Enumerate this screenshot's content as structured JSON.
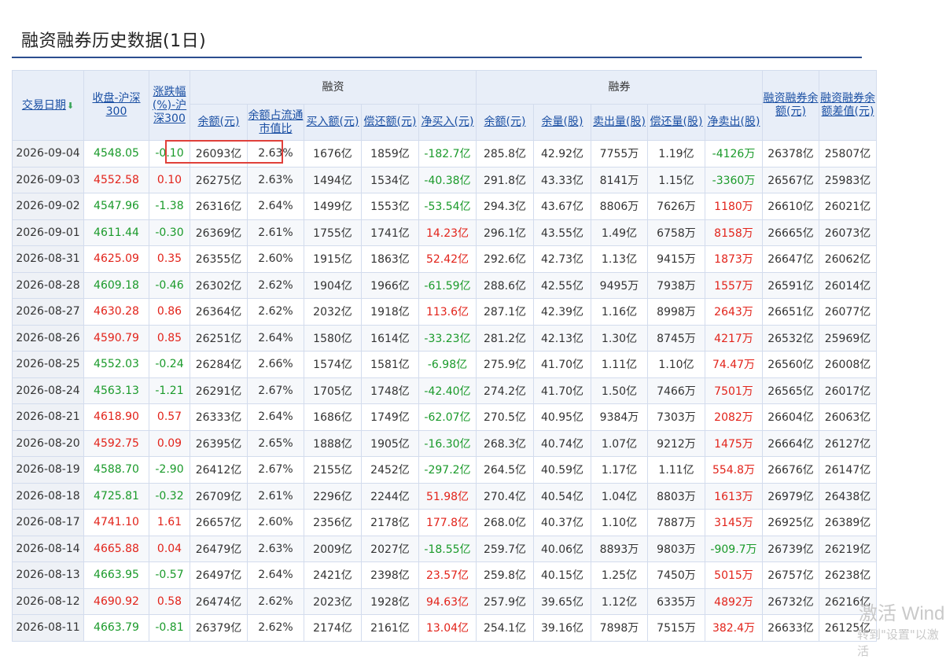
{
  "page": {
    "title": "融资融券历史数据(1日)"
  },
  "headers": {
    "date": "交易日期",
    "close": "收盘-沪深300",
    "change": "涨跌幅(%)-沪深300",
    "margin_group": "融资",
    "short_group": "融券",
    "m_balance": "余额(元)",
    "m_ratio": "余额占流通市值比",
    "m_buy": "买入额(元)",
    "m_repay": "偿还额(元)",
    "m_net": "净买入(元)",
    "s_balance": "余额(元)",
    "s_volume": "余量(股)",
    "s_sell": "卖出量(股)",
    "s_repay": "偿还量(股)",
    "s_net": "净卖出(股)",
    "total": "融资融券余额(元)",
    "diff": "融资融券余额差值(元)"
  },
  "rows": [
    {
      "date": "2026-09-04",
      "close": "4548.05",
      "chg": "-0.10",
      "mb": "26093亿",
      "mr": "2.63%",
      "buy": "1676亿",
      "repay": "1859亿",
      "net": "-182.7亿",
      "sb": "285.8亿",
      "sv": "42.92亿",
      "sell": "7755万",
      "srepay": "1.19亿",
      "snet": "-4126万",
      "total": "26378亿",
      "diff": "25807亿"
    },
    {
      "date": "2026-09-03",
      "close": "4552.58",
      "chg": "0.10",
      "mb": "26275亿",
      "mr": "2.63%",
      "buy": "1494亿",
      "repay": "1534亿",
      "net": "-40.38亿",
      "sb": "291.8亿",
      "sv": "43.33亿",
      "sell": "8141万",
      "srepay": "1.15亿",
      "snet": "-3360万",
      "total": "26567亿",
      "diff": "25983亿"
    },
    {
      "date": "2026-09-02",
      "close": "4547.96",
      "chg": "-1.38",
      "mb": "26316亿",
      "mr": "2.64%",
      "buy": "1499亿",
      "repay": "1553亿",
      "net": "-53.54亿",
      "sb": "294.3亿",
      "sv": "43.67亿",
      "sell": "8806万",
      "srepay": "7626万",
      "snet": "1180万",
      "total": "26610亿",
      "diff": "26021亿"
    },
    {
      "date": "2026-09-01",
      "close": "4611.44",
      "chg": "-0.30",
      "mb": "26369亿",
      "mr": "2.61%",
      "buy": "1755亿",
      "repay": "1741亿",
      "net": "14.23亿",
      "sb": "296.1亿",
      "sv": "43.55亿",
      "sell": "1.49亿",
      "srepay": "6758万",
      "snet": "8158万",
      "total": "26665亿",
      "diff": "26073亿"
    },
    {
      "date": "2026-08-31",
      "close": "4625.09",
      "chg": "0.35",
      "mb": "26355亿",
      "mr": "2.60%",
      "buy": "1915亿",
      "repay": "1863亿",
      "net": "52.42亿",
      "sb": "292.6亿",
      "sv": "42.73亿",
      "sell": "1.13亿",
      "srepay": "9415万",
      "snet": "1873万",
      "total": "26647亿",
      "diff": "26062亿"
    },
    {
      "date": "2026-08-28",
      "close": "4609.18",
      "chg": "-0.46",
      "mb": "26302亿",
      "mr": "2.62%",
      "buy": "1904亿",
      "repay": "1966亿",
      "net": "-61.59亿",
      "sb": "288.6亿",
      "sv": "42.55亿",
      "sell": "9495万",
      "srepay": "7938万",
      "snet": "1557万",
      "total": "26591亿",
      "diff": "26014亿"
    },
    {
      "date": "2026-08-27",
      "close": "4630.28",
      "chg": "0.86",
      "mb": "26364亿",
      "mr": "2.62%",
      "buy": "2032亿",
      "repay": "1918亿",
      "net": "113.6亿",
      "sb": "287.1亿",
      "sv": "42.39亿",
      "sell": "1.16亿",
      "srepay": "8998万",
      "snet": "2643万",
      "total": "26651亿",
      "diff": "26077亿"
    },
    {
      "date": "2026-08-26",
      "close": "4590.79",
      "chg": "0.85",
      "mb": "26251亿",
      "mr": "2.64%",
      "buy": "1580亿",
      "repay": "1614亿",
      "net": "-33.23亿",
      "sb": "281.2亿",
      "sv": "42.13亿",
      "sell": "1.30亿",
      "srepay": "8745万",
      "snet": "4217万",
      "total": "26532亿",
      "diff": "25969亿"
    },
    {
      "date": "2026-08-25",
      "close": "4552.03",
      "chg": "-0.24",
      "mb": "26284亿",
      "mr": "2.66%",
      "buy": "1574亿",
      "repay": "1581亿",
      "net": "-6.98亿",
      "sb": "275.9亿",
      "sv": "41.70亿",
      "sell": "1.11亿",
      "srepay": "1.10亿",
      "snet": "74.47万",
      "total": "26560亿",
      "diff": "26008亿"
    },
    {
      "date": "2026-08-24",
      "close": "4563.13",
      "chg": "-1.21",
      "mb": "26291亿",
      "mr": "2.67%",
      "buy": "1705亿",
      "repay": "1748亿",
      "net": "-42.40亿",
      "sb": "274.2亿",
      "sv": "41.70亿",
      "sell": "1.50亿",
      "srepay": "7466万",
      "snet": "7501万",
      "total": "26565亿",
      "diff": "26017亿"
    },
    {
      "date": "2026-08-21",
      "close": "4618.90",
      "chg": "0.57",
      "mb": "26333亿",
      "mr": "2.64%",
      "buy": "1686亿",
      "repay": "1749亿",
      "net": "-62.07亿",
      "sb": "270.5亿",
      "sv": "40.95亿",
      "sell": "9384万",
      "srepay": "7303万",
      "snet": "2082万",
      "total": "26604亿",
      "diff": "26063亿"
    },
    {
      "date": "2026-08-20",
      "close": "4592.75",
      "chg": "0.09",
      "mb": "26395亿",
      "mr": "2.65%",
      "buy": "1888亿",
      "repay": "1905亿",
      "net": "-16.30亿",
      "sb": "268.3亿",
      "sv": "40.74亿",
      "sell": "1.07亿",
      "srepay": "9212万",
      "snet": "1475万",
      "total": "26664亿",
      "diff": "26127亿"
    },
    {
      "date": "2026-08-19",
      "close": "4588.70",
      "chg": "-2.90",
      "mb": "26412亿",
      "mr": "2.67%",
      "buy": "2155亿",
      "repay": "2452亿",
      "net": "-297.2亿",
      "sb": "264.5亿",
      "sv": "40.59亿",
      "sell": "1.17亿",
      "srepay": "1.11亿",
      "snet": "554.8万",
      "total": "26676亿",
      "diff": "26147亿"
    },
    {
      "date": "2026-08-18",
      "close": "4725.81",
      "chg": "-0.32",
      "mb": "26709亿",
      "mr": "2.61%",
      "buy": "2296亿",
      "repay": "2244亿",
      "net": "51.98亿",
      "sb": "270.4亿",
      "sv": "40.54亿",
      "sell": "1.04亿",
      "srepay": "8803万",
      "snet": "1613万",
      "total": "26979亿",
      "diff": "26438亿"
    },
    {
      "date": "2026-08-17",
      "close": "4741.10",
      "chg": "1.61",
      "mb": "26657亿",
      "mr": "2.60%",
      "buy": "2356亿",
      "repay": "2178亿",
      "net": "177.8亿",
      "sb": "268.0亿",
      "sv": "40.37亿",
      "sell": "1.10亿",
      "srepay": "7887万",
      "snet": "3145万",
      "total": "26925亿",
      "diff": "26389亿"
    },
    {
      "date": "2026-08-14",
      "close": "4665.88",
      "chg": "0.04",
      "mb": "26479亿",
      "mr": "2.63%",
      "buy": "2009亿",
      "repay": "2027亿",
      "net": "-18.55亿",
      "sb": "259.7亿",
      "sv": "40.06亿",
      "sell": "8893万",
      "srepay": "9803万",
      "snet": "-909.7万",
      "total": "26739亿",
      "diff": "26219亿"
    },
    {
      "date": "2026-08-13",
      "close": "4663.95",
      "chg": "-0.57",
      "mb": "26497亿",
      "mr": "2.64%",
      "buy": "2421亿",
      "repay": "2398亿",
      "net": "23.57亿",
      "sb": "259.8亿",
      "sv": "40.15亿",
      "sell": "1.25亿",
      "srepay": "7450万",
      "snet": "5015万",
      "total": "26757亿",
      "diff": "26238亿"
    },
    {
      "date": "2026-08-12",
      "close": "4690.92",
      "chg": "0.58",
      "mb": "26474亿",
      "mr": "2.62%",
      "buy": "2023亿",
      "repay": "1928亿",
      "net": "94.63亿",
      "sb": "257.9亿",
      "sv": "39.65亿",
      "sell": "1.12亿",
      "srepay": "6335万",
      "snet": "4892万",
      "total": "26732亿",
      "diff": "26216亿"
    },
    {
      "date": "2026-08-11",
      "close": "4663.79",
      "chg": "-0.81",
      "mb": "26379亿",
      "mr": "2.62%",
      "buy": "2174亿",
      "repay": "2161亿",
      "net": "13.04亿",
      "sb": "254.1亿",
      "sv": "39.16亿",
      "sell": "7898万",
      "srepay": "7515万",
      "snet": "382.4万",
      "total": "26633亿",
      "diff": "26125亿"
    }
  ],
  "watermark": {
    "line1": "激活 Wind",
    "line2": "转到\"设置\"以激活"
  },
  "colors": {
    "up": "#e2231a",
    "down": "#1a9a2a",
    "header_bg": "#e8eef8",
    "rule": "#2b4e8f"
  }
}
